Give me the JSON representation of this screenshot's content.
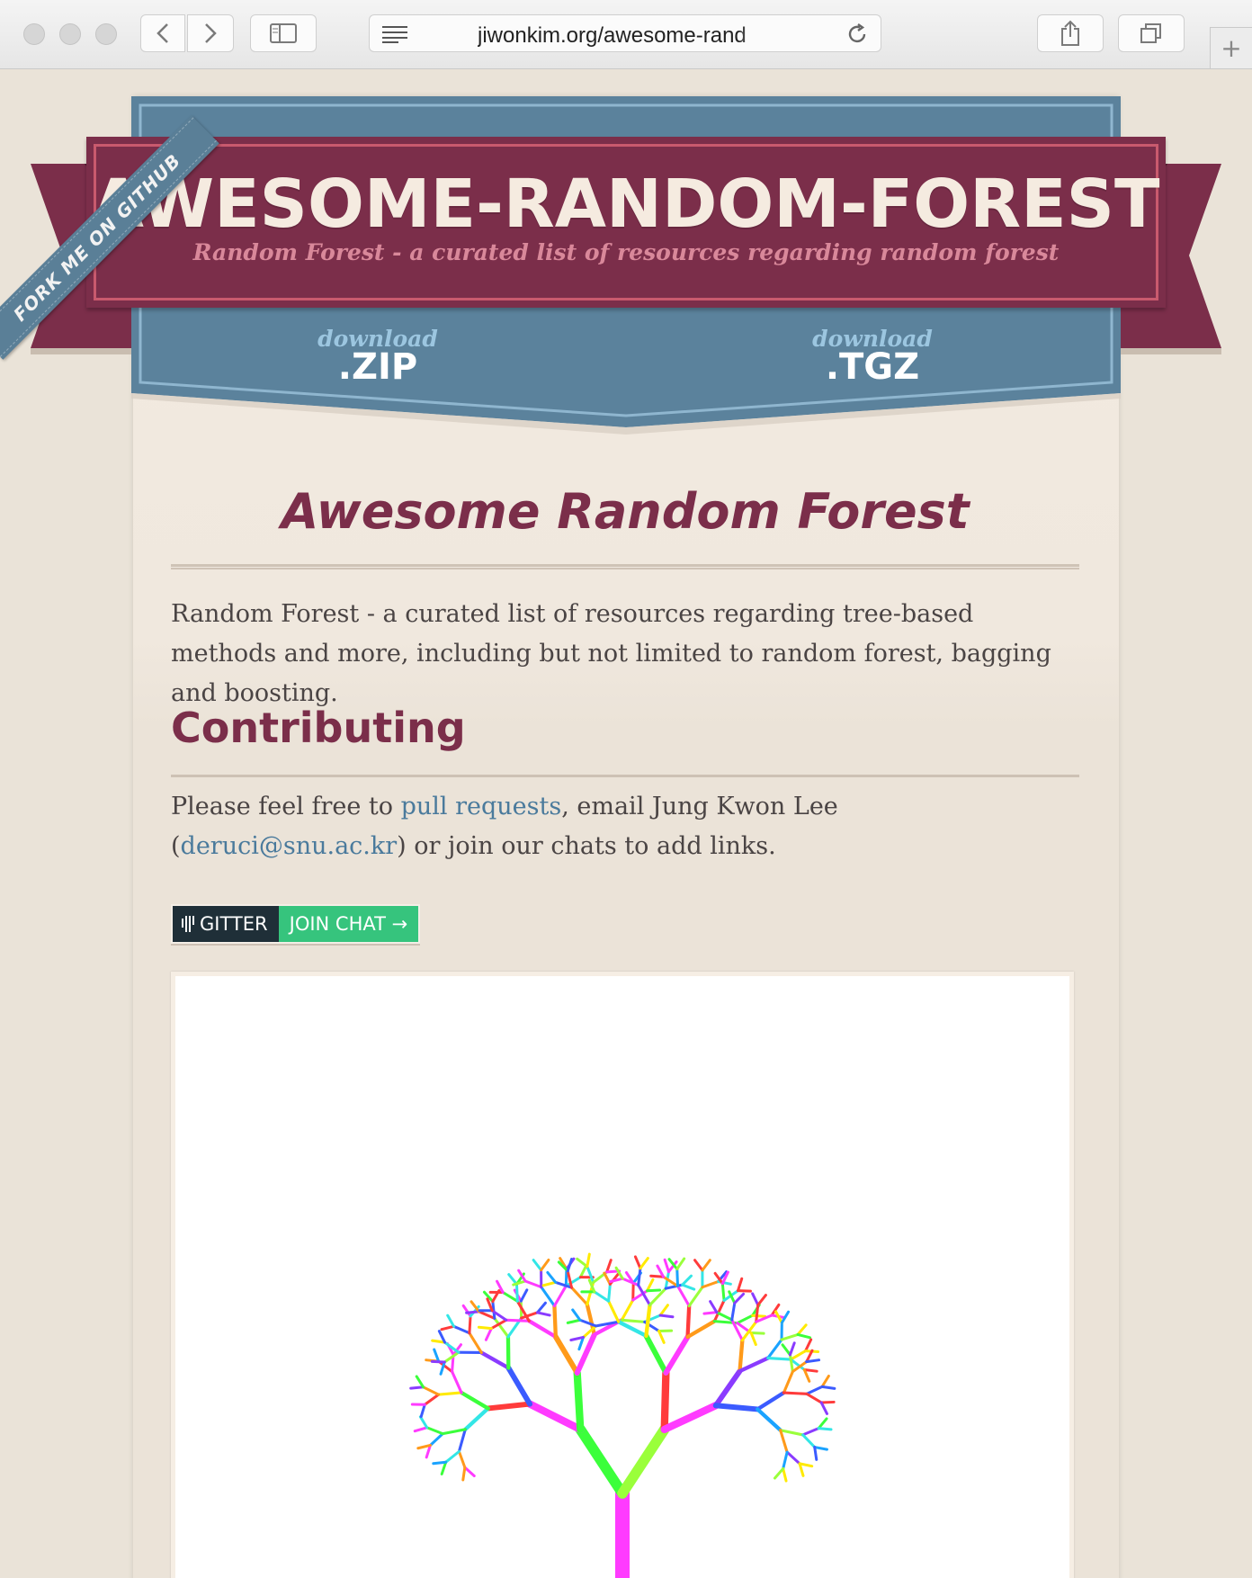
{
  "browser": {
    "url_text": "jiwonkim.org/awesome-rand",
    "icons": [
      "back-icon",
      "forward-icon",
      "sidebar-icon",
      "reader-icon",
      "reload-icon",
      "share-icon",
      "tabs-icon",
      "new-tab-icon"
    ]
  },
  "header": {
    "title": "AWESOME-RANDOM-FOREST",
    "subtitle": "Random Forest - a curated list of resources regarding random forest",
    "fork_ribbon": "FORK ME ON GITHUB",
    "downloads": [
      {
        "word": "download",
        "ext": ".ZIP"
      },
      {
        "word": "download",
        "ext": ".TGZ"
      }
    ]
  },
  "main": {
    "heading": "Awesome Random Forest",
    "intro": "Random Forest - a curated list of resources regarding tree-based methods and more, including but not limited to random forest, bagging and boosting.",
    "contributing": {
      "heading": "Contributing",
      "text_before": "Please feel free to ",
      "link1": "pull requests",
      "text_mid": ", email Jung Kwon Lee (",
      "link2": "deruci@snu.ac.kr",
      "text_after": ") or join our chats to add links."
    },
    "badge": {
      "left": "GITTER",
      "right": "JOIN CHAT →"
    }
  },
  "colors": {
    "maroon": "#7b2e4a",
    "steel_blue": "#5b829c",
    "page_bg": "#eae3d8",
    "link": "#4a7a9c",
    "gitter_green": "#36c47d"
  }
}
